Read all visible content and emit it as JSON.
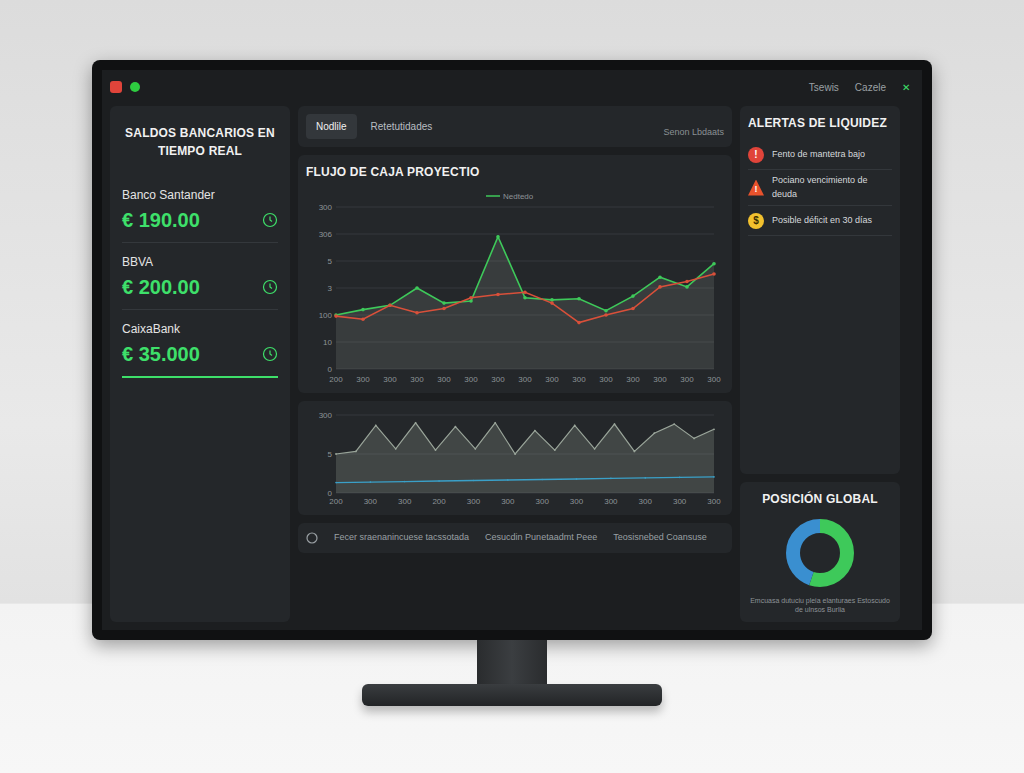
{
  "window": {
    "dots": [
      {
        "color": "#e0443a"
      },
      {
        "color": "#2ecc40"
      }
    ],
    "right": [
      "Tsewis",
      "Cazele"
    ],
    "close": "✕"
  },
  "tabs": [
    {
      "label": "Nodlile",
      "selected": true
    },
    {
      "label": "Retetutidades",
      "selected": false
    }
  ],
  "tabs_note": "Senon Lbdaats",
  "balances": {
    "title": "SALDOS BANCARIOS EN TIEMPO REAL",
    "accounts": [
      {
        "bank": "Banco Santander",
        "amount": "€ 190.00",
        "selected": false
      },
      {
        "bank": "BBVA",
        "amount": "€ 200.00",
        "selected": false
      },
      {
        "bank": "CaixaBank",
        "amount": "€ 35.000",
        "selected": true
      }
    ]
  },
  "cashflow": {
    "title": "FLUJO DE CAJA PROYECTIO",
    "legend": "Nedtedo",
    "y_max": 300,
    "y_ticks": [
      "0",
      "10",
      "100",
      "3",
      "5",
      "306",
      "300"
    ],
    "x_ticks": [
      "200",
      "300",
      "300",
      "300",
      "300",
      "300",
      "300",
      "300",
      "300",
      "300",
      "300",
      "300",
      "300",
      "300",
      "300"
    ],
    "series": [
      {
        "color": "#3ec95a",
        "values": [
          100,
          110,
          118,
          150,
          122,
          126,
          245,
          132,
          128,
          130,
          108,
          135,
          170,
          152,
          195
        ]
      },
      {
        "color": "#d9503a",
        "values": [
          98,
          92,
          118,
          104,
          112,
          132,
          138,
          142,
          122,
          86,
          100,
          112,
          152,
          162,
          176
        ]
      }
    ]
  },
  "volume": {
    "y_max": 300,
    "y_ticks": [
      "0",
      "5",
      "300"
    ],
    "x_ticks": [
      "200",
      "300",
      "300",
      "200",
      "300",
      "300",
      "300",
      "300",
      "300",
      "300",
      "300",
      "300"
    ],
    "series": {
      "color": "#9aa59a",
      "values": [
        150,
        160,
        260,
        170,
        270,
        165,
        255,
        170,
        270,
        150,
        240,
        165,
        260,
        170,
        265,
        160,
        230,
        265,
        210,
        245
      ]
    },
    "baseline": {
      "color": "#3aa0c8",
      "values": [
        40,
        42,
        44,
        46,
        48,
        50,
        52,
        54,
        56,
        58,
        60,
        62
      ]
    }
  },
  "alerts": {
    "title": "ALERTAS DE LIQUIDEZ",
    "items": [
      {
        "text": "Fento de mantetra bajo",
        "icon": "!",
        "kind": "circle",
        "color": "#e0443a"
      },
      {
        "text": "Pociano vencimiento de deuda",
        "icon": "!",
        "kind": "triangle",
        "color": "#e8522c"
      },
      {
        "text": "Posible déficit en 30 días",
        "icon": "$",
        "kind": "circle",
        "color": "#f2c12e"
      }
    ]
  },
  "global": {
    "title": "POSICIÓN GLOBAL",
    "segments": [
      {
        "value": 55,
        "color": "#3ec95a"
      },
      {
        "value": 45,
        "color": "#3a8fd0"
      }
    ],
    "caption": "Emcuasa dutuciu pleia elanturaes Estoscudo de ulnsos Burlia"
  },
  "footer": {
    "items": [
      "Fecer sraenanincuese tacssotada",
      "Cesucdin Punetaadmt Peee",
      "Teosisnebed Coansuse"
    ]
  }
}
